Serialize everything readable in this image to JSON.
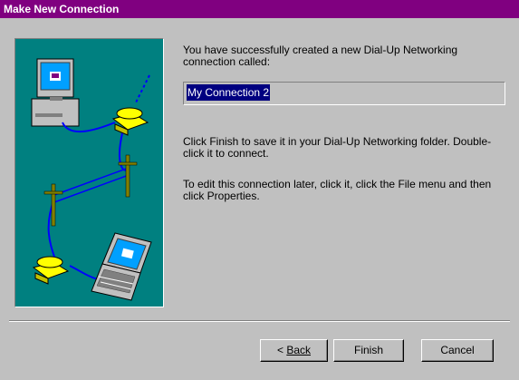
{
  "window": {
    "title": "Make New Connection"
  },
  "content": {
    "intro_text": "You have successfully created a new Dial-Up Networking connection called:",
    "connection_name": "My Connection 2",
    "finish_info": "Click Finish to save it in your Dial-Up Networking folder. Double-click it to connect.",
    "edit_info": "To edit this connection later, click it, click the File menu and then click Properties."
  },
  "buttons": {
    "back_arrow": "<",
    "back_label": "Back",
    "finish_label": "Finish",
    "cancel_label": "Cancel"
  },
  "colors": {
    "titlebar": "#800080",
    "illustration_bg": "#008080",
    "selection": "#000080"
  }
}
